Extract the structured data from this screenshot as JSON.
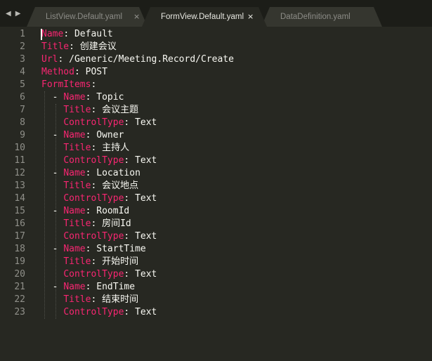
{
  "tabs": [
    {
      "label": "ListView.Default.yaml",
      "active": false
    },
    {
      "label": "FormView.Default.yaml",
      "active": true
    },
    {
      "label": "DataDefinition.yaml",
      "active": false
    }
  ],
  "icons": {
    "nav_back": "◀",
    "nav_forward": "▶",
    "close": "×"
  },
  "colors": {
    "background": "#272822",
    "key": "#f92672",
    "value": "#e6db74",
    "punct": "#f8f8f2",
    "line_number": "#90908a"
  },
  "lines": [
    {
      "n": "1",
      "indent": "",
      "dash": "",
      "key": "Name",
      "value": "Default"
    },
    {
      "n": "2",
      "indent": "",
      "dash": "",
      "key": "Title",
      "value": "创建会议"
    },
    {
      "n": "3",
      "indent": "",
      "dash": "",
      "key": "Url",
      "value": "/Generic/Meeting.Record/Create"
    },
    {
      "n": "4",
      "indent": "",
      "dash": "",
      "key": "Method",
      "value": "POST"
    },
    {
      "n": "5",
      "indent": "",
      "dash": "",
      "key": "FormItems",
      "value": ""
    },
    {
      "n": "6",
      "indent": "  ",
      "dash": "- ",
      "key": "Name",
      "value": "Topic"
    },
    {
      "n": "7",
      "indent": "    ",
      "dash": "",
      "key": "Title",
      "value": "会议主题"
    },
    {
      "n": "8",
      "indent": "    ",
      "dash": "",
      "key": "ControlType",
      "value": "Text"
    },
    {
      "n": "9",
      "indent": "  ",
      "dash": "- ",
      "key": "Name",
      "value": "Owner"
    },
    {
      "n": "10",
      "indent": "    ",
      "dash": "",
      "key": "Title",
      "value": "主持人"
    },
    {
      "n": "11",
      "indent": "    ",
      "dash": "",
      "key": "ControlType",
      "value": "Text"
    },
    {
      "n": "12",
      "indent": "  ",
      "dash": "- ",
      "key": "Name",
      "value": "Location"
    },
    {
      "n": "13",
      "indent": "    ",
      "dash": "",
      "key": "Title",
      "value": "会议地点"
    },
    {
      "n": "14",
      "indent": "    ",
      "dash": "",
      "key": "ControlType",
      "value": "Text"
    },
    {
      "n": "15",
      "indent": "  ",
      "dash": "- ",
      "key": "Name",
      "value": "RoomId"
    },
    {
      "n": "16",
      "indent": "    ",
      "dash": "",
      "key": "Title",
      "value": "房间Id"
    },
    {
      "n": "17",
      "indent": "    ",
      "dash": "",
      "key": "ControlType",
      "value": "Text"
    },
    {
      "n": "18",
      "indent": "  ",
      "dash": "- ",
      "key": "Name",
      "value": "StartTime"
    },
    {
      "n": "19",
      "indent": "    ",
      "dash": "",
      "key": "Title",
      "value": "开始时间"
    },
    {
      "n": "20",
      "indent": "    ",
      "dash": "",
      "key": "ControlType",
      "value": "Text"
    },
    {
      "n": "21",
      "indent": "  ",
      "dash": "- ",
      "key": "Name",
      "value": "EndTime"
    },
    {
      "n": "22",
      "indent": "    ",
      "dash": "",
      "key": "Title",
      "value": "结束时间"
    },
    {
      "n": "23",
      "indent": "    ",
      "dash": "",
      "key": "ControlType",
      "value": "Text"
    }
  ]
}
